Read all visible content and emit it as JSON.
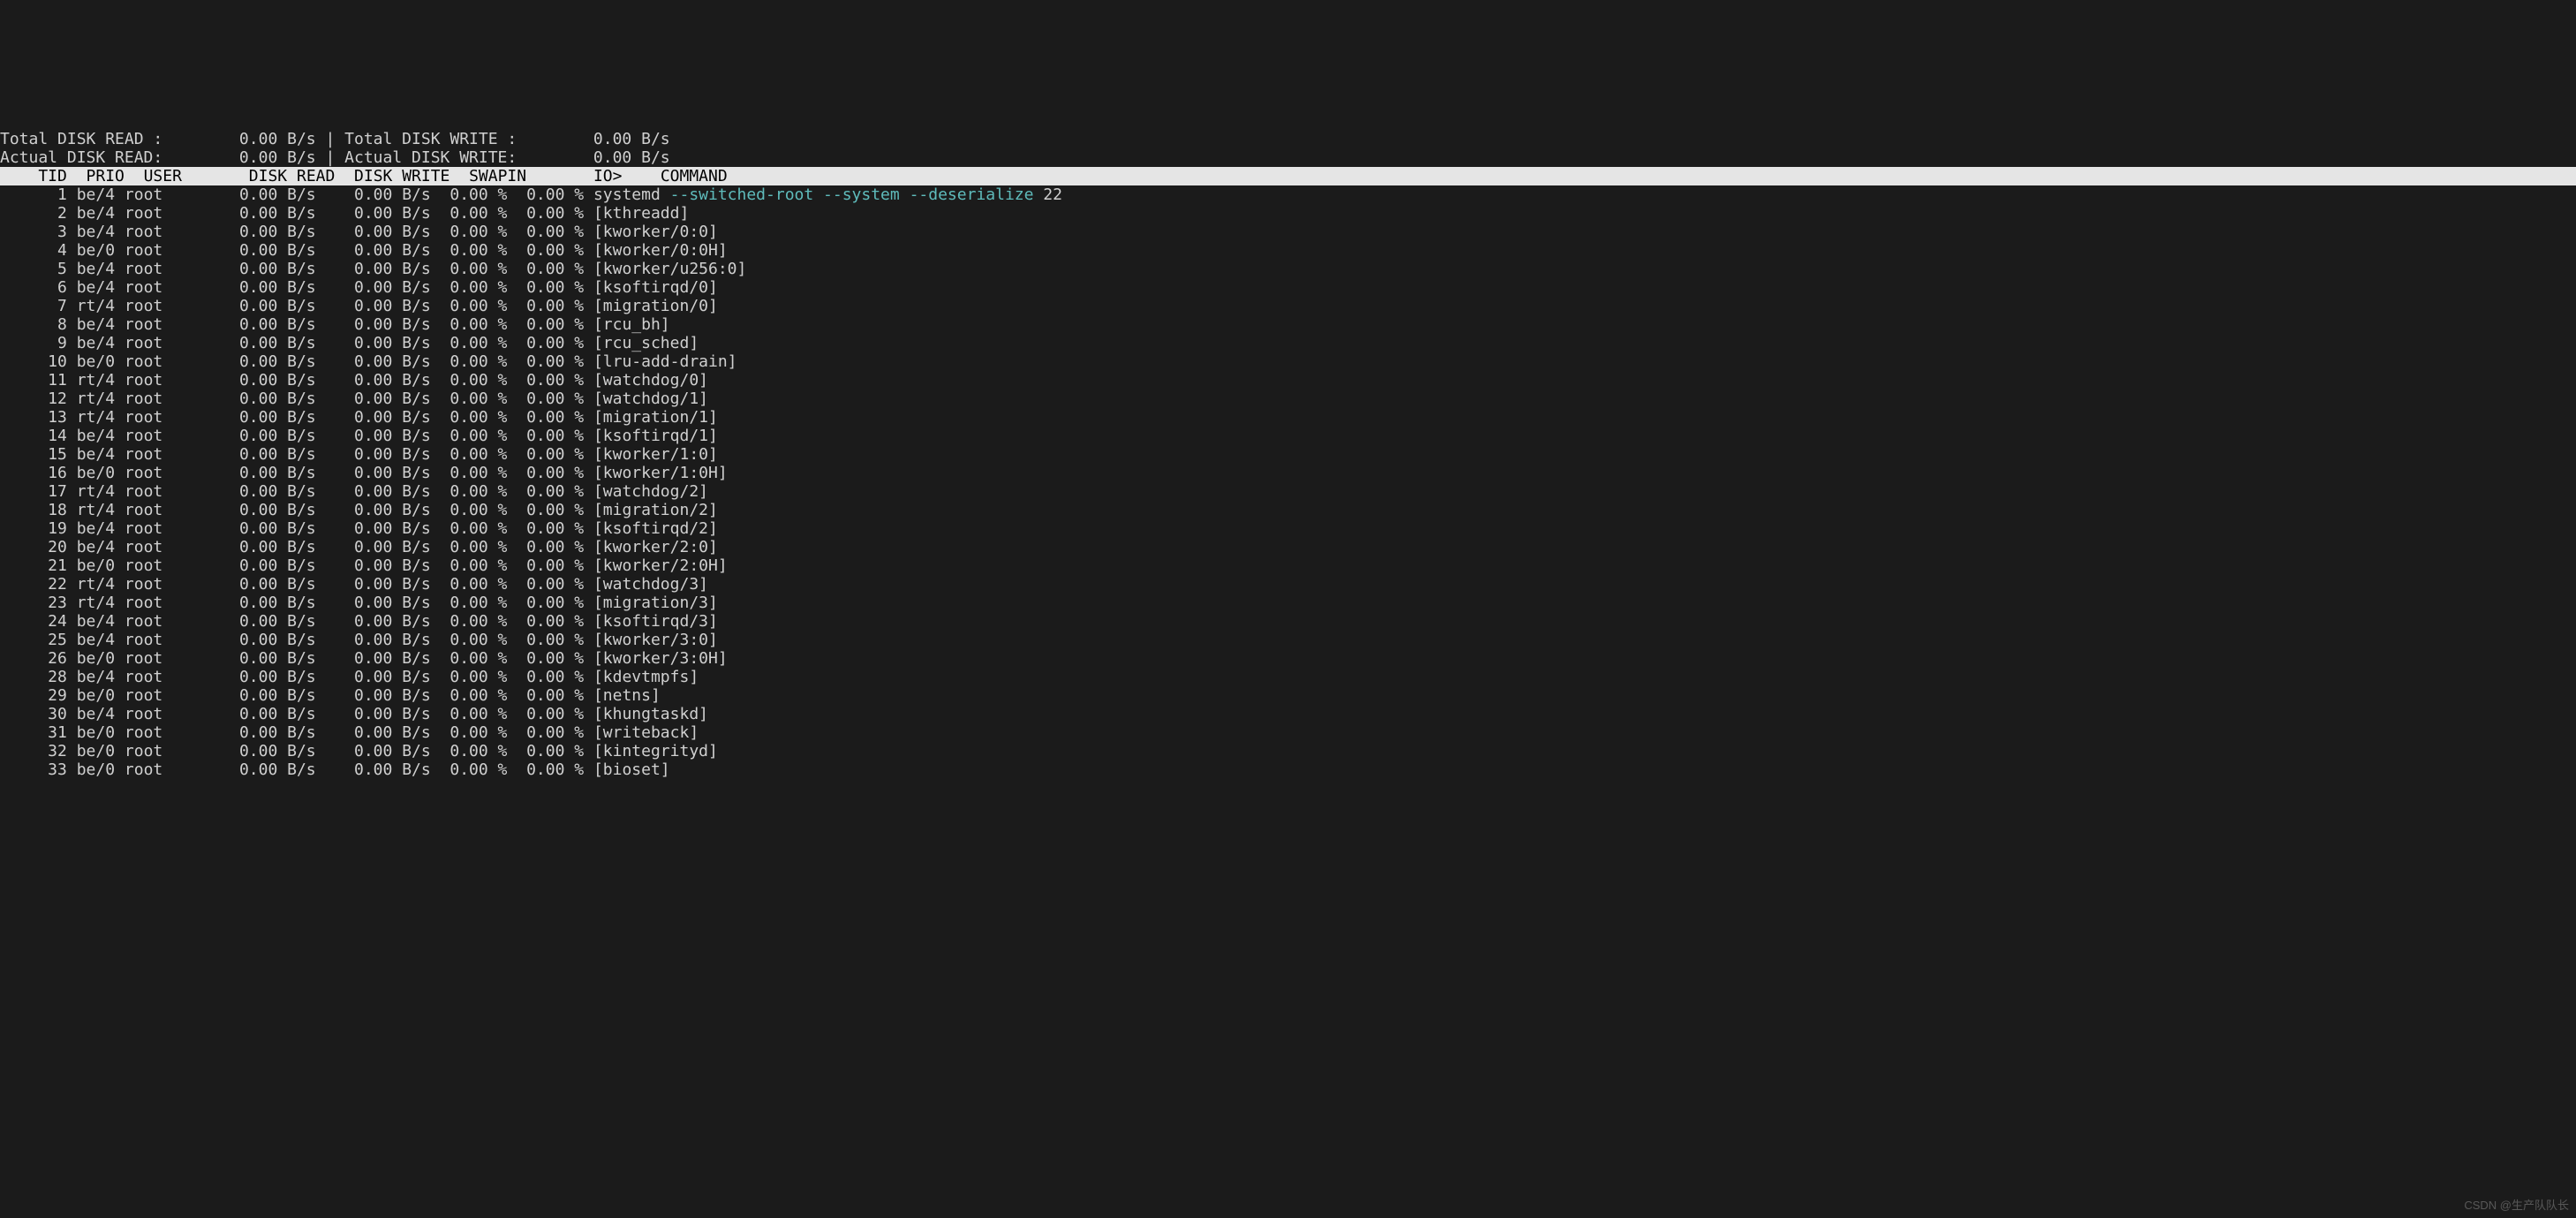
{
  "summary": {
    "line1": {
      "total_disk_read_label": "Total DISK READ :",
      "total_disk_read_value": "0.00 B/s",
      "sep": "|",
      "total_disk_write_label": "Total DISK WRITE :",
      "total_disk_write_value": "0.00 B/s"
    },
    "line2": {
      "actual_disk_read_label": "Actual DISK READ:",
      "actual_disk_read_value": "0.00 B/s",
      "sep": "|",
      "actual_disk_write_label": "Actual DISK WRITE:",
      "actual_disk_write_value": "0.00 B/s"
    }
  },
  "header": {
    "tid": "TID",
    "prio": "PRIO",
    "user": "USER",
    "disk_read": "DISK READ",
    "disk_write": "DISK WRITE",
    "swapin": "SWAPIN",
    "io": "IO>",
    "command": "COMMAND"
  },
  "rows": [
    {
      "tid": "1",
      "prio": "be/4",
      "user": "root",
      "disk_read": "0.00 B/s",
      "disk_write": "0.00 B/s",
      "swapin": "0.00 %",
      "io": "0.00 %",
      "command": "systemd",
      "args": "--switched-root --system --deserialize",
      "trailing": "22"
    },
    {
      "tid": "2",
      "prio": "be/4",
      "user": "root",
      "disk_read": "0.00 B/s",
      "disk_write": "0.00 B/s",
      "swapin": "0.00 %",
      "io": "0.00 %",
      "command": "[kthreadd]"
    },
    {
      "tid": "3",
      "prio": "be/4",
      "user": "root",
      "disk_read": "0.00 B/s",
      "disk_write": "0.00 B/s",
      "swapin": "0.00 %",
      "io": "0.00 %",
      "command": "[kworker/0:0]"
    },
    {
      "tid": "4",
      "prio": "be/0",
      "user": "root",
      "disk_read": "0.00 B/s",
      "disk_write": "0.00 B/s",
      "swapin": "0.00 %",
      "io": "0.00 %",
      "command": "[kworker/0:0H]"
    },
    {
      "tid": "5",
      "prio": "be/4",
      "user": "root",
      "disk_read": "0.00 B/s",
      "disk_write": "0.00 B/s",
      "swapin": "0.00 %",
      "io": "0.00 %",
      "command": "[kworker/u256:0]"
    },
    {
      "tid": "6",
      "prio": "be/4",
      "user": "root",
      "disk_read": "0.00 B/s",
      "disk_write": "0.00 B/s",
      "swapin": "0.00 %",
      "io": "0.00 %",
      "command": "[ksoftirqd/0]"
    },
    {
      "tid": "7",
      "prio": "rt/4",
      "user": "root",
      "disk_read": "0.00 B/s",
      "disk_write": "0.00 B/s",
      "swapin": "0.00 %",
      "io": "0.00 %",
      "command": "[migration/0]"
    },
    {
      "tid": "8",
      "prio": "be/4",
      "user": "root",
      "disk_read": "0.00 B/s",
      "disk_write": "0.00 B/s",
      "swapin": "0.00 %",
      "io": "0.00 %",
      "command": "[rcu_bh]"
    },
    {
      "tid": "9",
      "prio": "be/4",
      "user": "root",
      "disk_read": "0.00 B/s",
      "disk_write": "0.00 B/s",
      "swapin": "0.00 %",
      "io": "0.00 %",
      "command": "[rcu_sched]"
    },
    {
      "tid": "10",
      "prio": "be/0",
      "user": "root",
      "disk_read": "0.00 B/s",
      "disk_write": "0.00 B/s",
      "swapin": "0.00 %",
      "io": "0.00 %",
      "command": "[lru-add-drain]"
    },
    {
      "tid": "11",
      "prio": "rt/4",
      "user": "root",
      "disk_read": "0.00 B/s",
      "disk_write": "0.00 B/s",
      "swapin": "0.00 %",
      "io": "0.00 %",
      "command": "[watchdog/0]"
    },
    {
      "tid": "12",
      "prio": "rt/4",
      "user": "root",
      "disk_read": "0.00 B/s",
      "disk_write": "0.00 B/s",
      "swapin": "0.00 %",
      "io": "0.00 %",
      "command": "[watchdog/1]"
    },
    {
      "tid": "13",
      "prio": "rt/4",
      "user": "root",
      "disk_read": "0.00 B/s",
      "disk_write": "0.00 B/s",
      "swapin": "0.00 %",
      "io": "0.00 %",
      "command": "[migration/1]"
    },
    {
      "tid": "14",
      "prio": "be/4",
      "user": "root",
      "disk_read": "0.00 B/s",
      "disk_write": "0.00 B/s",
      "swapin": "0.00 %",
      "io": "0.00 %",
      "command": "[ksoftirqd/1]"
    },
    {
      "tid": "15",
      "prio": "be/4",
      "user": "root",
      "disk_read": "0.00 B/s",
      "disk_write": "0.00 B/s",
      "swapin": "0.00 %",
      "io": "0.00 %",
      "command": "[kworker/1:0]"
    },
    {
      "tid": "16",
      "prio": "be/0",
      "user": "root",
      "disk_read": "0.00 B/s",
      "disk_write": "0.00 B/s",
      "swapin": "0.00 %",
      "io": "0.00 %",
      "command": "[kworker/1:0H]"
    },
    {
      "tid": "17",
      "prio": "rt/4",
      "user": "root",
      "disk_read": "0.00 B/s",
      "disk_write": "0.00 B/s",
      "swapin": "0.00 %",
      "io": "0.00 %",
      "command": "[watchdog/2]"
    },
    {
      "tid": "18",
      "prio": "rt/4",
      "user": "root",
      "disk_read": "0.00 B/s",
      "disk_write": "0.00 B/s",
      "swapin": "0.00 %",
      "io": "0.00 %",
      "command": "[migration/2]"
    },
    {
      "tid": "19",
      "prio": "be/4",
      "user": "root",
      "disk_read": "0.00 B/s",
      "disk_write": "0.00 B/s",
      "swapin": "0.00 %",
      "io": "0.00 %",
      "command": "[ksoftirqd/2]"
    },
    {
      "tid": "20",
      "prio": "be/4",
      "user": "root",
      "disk_read": "0.00 B/s",
      "disk_write": "0.00 B/s",
      "swapin": "0.00 %",
      "io": "0.00 %",
      "command": "[kworker/2:0]"
    },
    {
      "tid": "21",
      "prio": "be/0",
      "user": "root",
      "disk_read": "0.00 B/s",
      "disk_write": "0.00 B/s",
      "swapin": "0.00 %",
      "io": "0.00 %",
      "command": "[kworker/2:0H]"
    },
    {
      "tid": "22",
      "prio": "rt/4",
      "user": "root",
      "disk_read": "0.00 B/s",
      "disk_write": "0.00 B/s",
      "swapin": "0.00 %",
      "io": "0.00 %",
      "command": "[watchdog/3]"
    },
    {
      "tid": "23",
      "prio": "rt/4",
      "user": "root",
      "disk_read": "0.00 B/s",
      "disk_write": "0.00 B/s",
      "swapin": "0.00 %",
      "io": "0.00 %",
      "command": "[migration/3]"
    },
    {
      "tid": "24",
      "prio": "be/4",
      "user": "root",
      "disk_read": "0.00 B/s",
      "disk_write": "0.00 B/s",
      "swapin": "0.00 %",
      "io": "0.00 %",
      "command": "[ksoftirqd/3]"
    },
    {
      "tid": "25",
      "prio": "be/4",
      "user": "root",
      "disk_read": "0.00 B/s",
      "disk_write": "0.00 B/s",
      "swapin": "0.00 %",
      "io": "0.00 %",
      "command": "[kworker/3:0]"
    },
    {
      "tid": "26",
      "prio": "be/0",
      "user": "root",
      "disk_read": "0.00 B/s",
      "disk_write": "0.00 B/s",
      "swapin": "0.00 %",
      "io": "0.00 %",
      "command": "[kworker/3:0H]"
    },
    {
      "tid": "28",
      "prio": "be/4",
      "user": "root",
      "disk_read": "0.00 B/s",
      "disk_write": "0.00 B/s",
      "swapin": "0.00 %",
      "io": "0.00 %",
      "command": "[kdevtmpfs]"
    },
    {
      "tid": "29",
      "prio": "be/0",
      "user": "root",
      "disk_read": "0.00 B/s",
      "disk_write": "0.00 B/s",
      "swapin": "0.00 %",
      "io": "0.00 %",
      "command": "[netns]"
    },
    {
      "tid": "30",
      "prio": "be/4",
      "user": "root",
      "disk_read": "0.00 B/s",
      "disk_write": "0.00 B/s",
      "swapin": "0.00 %",
      "io": "0.00 %",
      "command": "[khungtaskd]"
    },
    {
      "tid": "31",
      "prio": "be/0",
      "user": "root",
      "disk_read": "0.00 B/s",
      "disk_write": "0.00 B/s",
      "swapin": "0.00 %",
      "io": "0.00 %",
      "command": "[writeback]"
    },
    {
      "tid": "32",
      "prio": "be/0",
      "user": "root",
      "disk_read": "0.00 B/s",
      "disk_write": "0.00 B/s",
      "swapin": "0.00 %",
      "io": "0.00 %",
      "command": "[kintegrityd]"
    },
    {
      "tid": "33",
      "prio": "be/0",
      "user": "root",
      "disk_read": "0.00 B/s",
      "disk_write": "0.00 B/s",
      "swapin": "0.00 %",
      "io": "0.00 %",
      "command": "[bioset]"
    }
  ],
  "watermark": "CSDN @生产队队长"
}
